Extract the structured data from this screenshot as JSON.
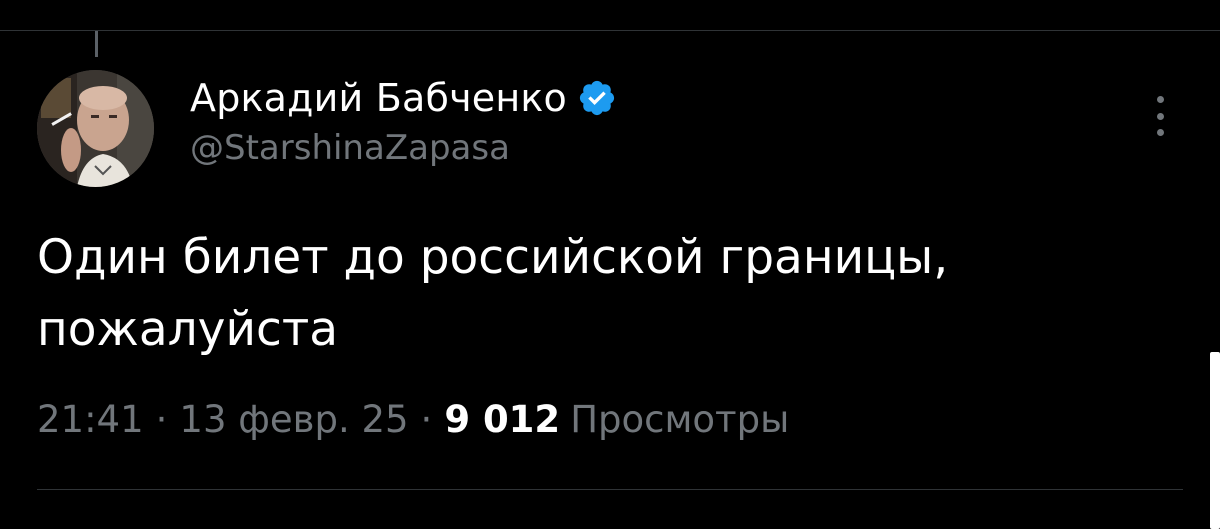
{
  "tweet": {
    "author": {
      "display_name": "Аркадий Бабченко",
      "handle": "@StarshinaZapasa",
      "verified": true,
      "verified_icon": "verified-badge-icon",
      "verified_color": "#1d9bf0"
    },
    "text": "Один билет до российской границы,\nпожалуйста",
    "meta": {
      "time": "21:41",
      "date": "13 февр. 25",
      "separator": "·",
      "views_count": "9 012",
      "views_label": "Просмотры"
    },
    "more_icon": "more-vertical-icon"
  },
  "colors": {
    "background": "#000000",
    "text_primary": "#ffffff",
    "text_secondary": "#71767b",
    "divider": "#2f3336",
    "accent": "#1d9bf0"
  }
}
